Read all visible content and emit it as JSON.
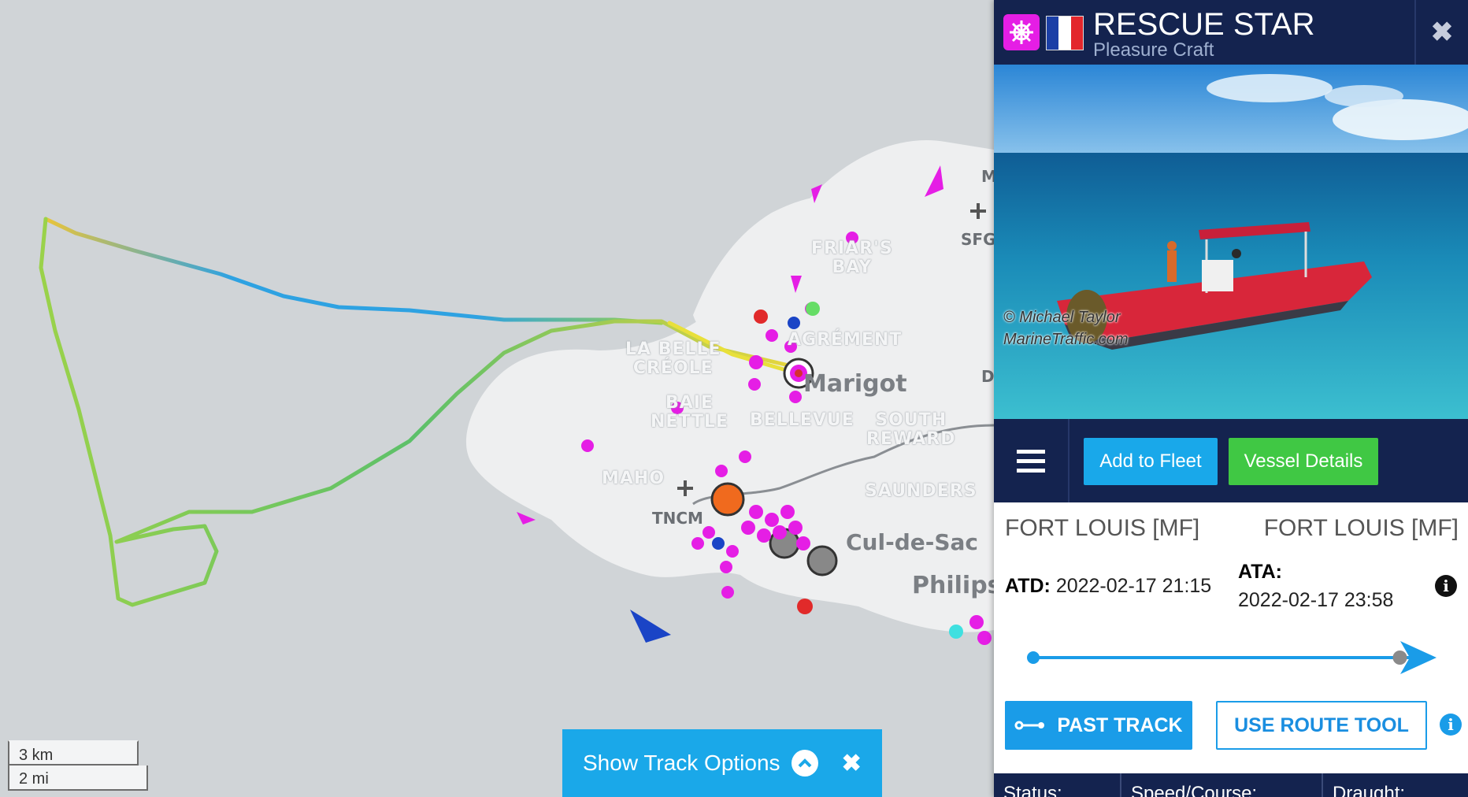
{
  "map": {
    "places": {
      "friars_bay": "FRIAR'S\nBAY",
      "agrement": "AGRÉMENT",
      "la_belle_creole": "LA BELLE\nCRÉOLE",
      "baie_nettle": "BAIE\nNETTLE",
      "bellevue": "BELLEVUE",
      "south_reward": "SOUTH\nREWARD",
      "maho": "MAHO",
      "saunders": "SAUNDERS",
      "marigot": "Marigot",
      "cul_de_sac": "Cul-de-Sac",
      "philipsburg": "Philipsb",
      "sfg": "SFG",
      "tncm": "TNCM",
      "edge_m": "M",
      "edge_d": "D"
    },
    "scale": {
      "km": "3 km",
      "mi": "2 mi"
    },
    "track_options": {
      "label": "Show Track Options",
      "close": "✖"
    }
  },
  "panel": {
    "vessel_name": "RESCUE STAR",
    "vessel_type": "Pleasure Craft",
    "type_icon": "ship-wheel-icon",
    "flag": "France",
    "close": "✖",
    "photo_credit_1": "© Michael Taylor",
    "photo_credit_2": "MarineTraffic.com",
    "add_to_fleet": "Add to Fleet",
    "vessel_details": "Vessel Details",
    "departure_port": "FORT LOUIS [MF]",
    "arrival_port": "FORT LOUIS [MF]",
    "atd_label": "ATD:",
    "atd_value": "2022-02-17 21:15",
    "ata_label": "ATA:",
    "ata_value": "2022-02-17 23:58",
    "progress": 0.95,
    "past_track": "PAST TRACK",
    "route_tool": "USE ROUTE TOOL",
    "stats": [
      "Status:",
      "Speed/Course:",
      "Draught:"
    ]
  },
  "colors": {
    "panel_header": "#14234f",
    "accent_blue": "#1a9ce8",
    "green": "#40c844",
    "vessel_marker": "#e51ee5"
  }
}
